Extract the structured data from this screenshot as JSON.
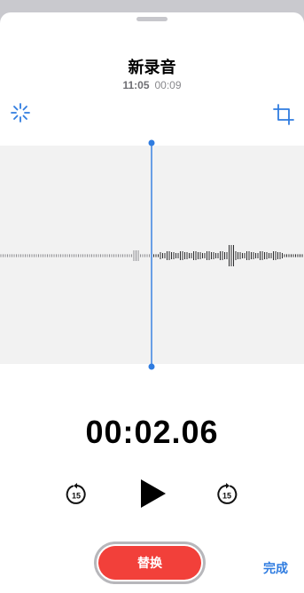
{
  "header": {
    "title": "新录音",
    "time": "11:05",
    "duration": "00:09"
  },
  "icons": {
    "enhance": "magic-wand-icon",
    "crop": "crop-icon",
    "accent": "#2f7ce0"
  },
  "playback": {
    "elapsed": "00:02.06",
    "skip_back_label": "15",
    "skip_forward_label": "15",
    "play_icon": "play-icon"
  },
  "actions": {
    "replace_label": "替换",
    "done_label": "完成",
    "replace_color": "#f2403a"
  }
}
